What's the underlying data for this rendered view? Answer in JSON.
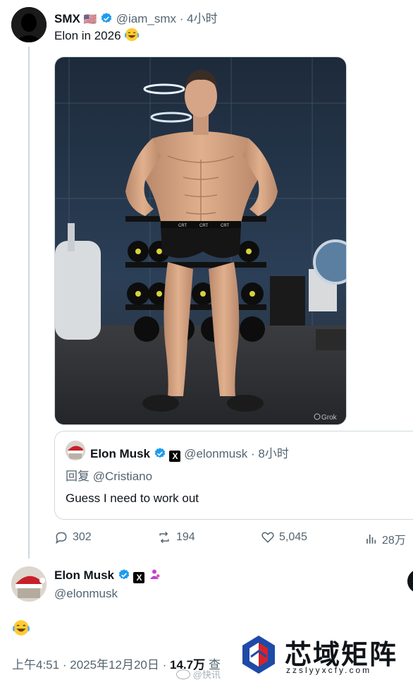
{
  "first_tweet": {
    "author_name": "SMX",
    "flag_emoji": "🇺🇸",
    "handle": "@iam_smx",
    "time_sep": "·",
    "time": "4小时",
    "text": "Elon in 2026",
    "emoji_name": "face-with-tears-of-joy",
    "image_watermark": "Grok",
    "shirt_label": "CRT"
  },
  "quoted_tweet": {
    "author_name": "Elon Musk",
    "x_badge": "X",
    "handle": "@elonmusk",
    "time_sep": "·",
    "time": "8小时",
    "reply_prefix": "回复",
    "reply_to": "@Cristiano",
    "text": "Guess I need to work out"
  },
  "actions": {
    "replies": "302",
    "reposts": "194",
    "likes": "5,045",
    "views": "28万"
  },
  "main_tweet": {
    "author_name": "Elon Musk",
    "x_badge": "X",
    "handle": "@elonmusk",
    "emoji_name": "face-with-tears-of-joy",
    "time": "上午4:51",
    "sep1": "·",
    "date": "2025年12月20日",
    "sep2": "·",
    "view_count": "14.7万",
    "view_label_partial": "查"
  },
  "watermark": {
    "weibo_text": "@快讯",
    "brand_cn": "芯域矩阵",
    "brand_url": "zzslyyxcfy.com"
  },
  "colors": {
    "verified_blue": "#1d9bf0",
    "muted_text": "#536471",
    "border": "#cfd9de",
    "brand_blue": "#1e4aa8",
    "brand_red": "#d6232a"
  }
}
